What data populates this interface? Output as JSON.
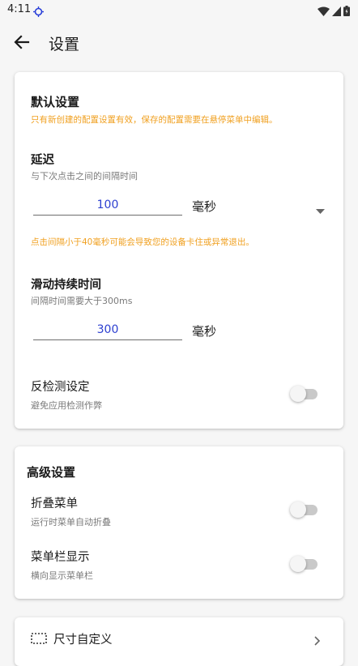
{
  "status": {
    "time": "4:11"
  },
  "header": {
    "title": "设置"
  },
  "default_settings": {
    "title": "默认设置",
    "note": "只有新创建的配置设置有效，保存的配置需要在悬停菜单中编辑。",
    "delay": {
      "title": "延迟",
      "subtitle": "与下次点击之间的间隔时间",
      "value": "100",
      "unit": "毫秒",
      "warning": "点击间隔小于40毫秒可能会导致您的设备卡住或异常退出。"
    },
    "swipe": {
      "title": "滑动持续时间",
      "subtitle": "间隔时间需要大于300ms",
      "value": "300",
      "unit": "毫秒"
    },
    "anti_detect": {
      "title": "反检测设定",
      "subtitle": "避免应用检测作弊",
      "enabled": false
    }
  },
  "advanced_settings": {
    "title": "高级设置",
    "fold_menu": {
      "title": "折叠菜单",
      "subtitle": "运行时菜单自动折叠",
      "enabled": false
    },
    "menu_bar": {
      "title": "菜单栏显示",
      "subtitle": "横向显示菜单栏",
      "enabled": false
    }
  },
  "bottom_card": {
    "title": "尺寸自定义"
  }
}
